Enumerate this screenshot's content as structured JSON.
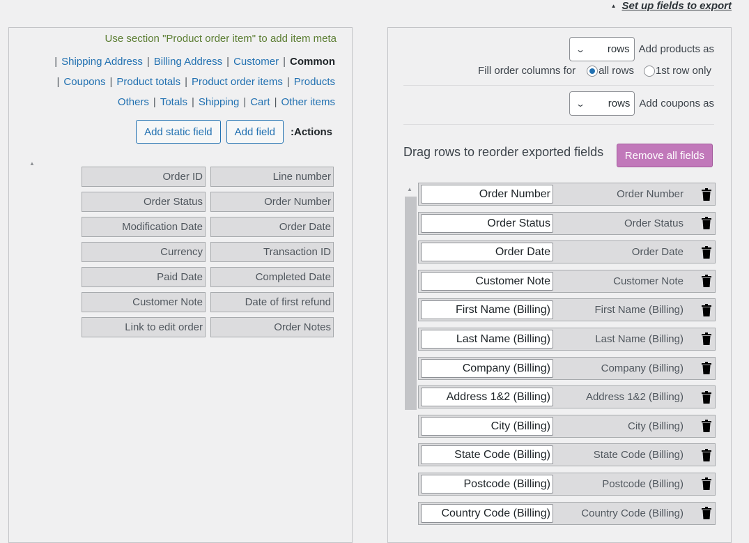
{
  "header": {
    "setup_link": "Set up fields to export"
  },
  "left": {
    "hint": "Use section \"Product order item\" to add item meta",
    "sections_row1": [
      {
        "label": "Shipping Address",
        "current": false
      },
      {
        "label": "Billing Address",
        "current": false
      },
      {
        "label": "Customer",
        "current": false
      },
      {
        "label": "Common",
        "current": true
      }
    ],
    "sections_row2": [
      {
        "label": "Coupons",
        "current": false
      },
      {
        "label": "Product totals",
        "current": false
      },
      {
        "label": "Product order items",
        "current": false
      },
      {
        "label": "Products",
        "current": false
      }
    ],
    "sections_row3": [
      {
        "label": "Others",
        "current": false
      },
      {
        "label": "Totals",
        "current": false
      },
      {
        "label": "Shipping",
        "current": false
      },
      {
        "label": "Cart",
        "current": false
      },
      {
        "label": "Other items",
        "current": false
      }
    ],
    "add_static_field": "Add static field",
    "add_field": "Add field",
    "actions_label": ":Actions",
    "available_fields": [
      "Order ID",
      "Line number",
      "Order Status",
      "Order Number",
      "Modification Date",
      "Order Date",
      "Currency",
      "Transaction ID",
      "Paid Date",
      "Completed Date",
      "Customer Note",
      "Date of first refund",
      "Link to edit order",
      "Order Notes"
    ]
  },
  "right": {
    "products_select": "rows",
    "products_label": "Add products as",
    "fill_label": "Fill order columns for",
    "radio_all": "all rows",
    "radio_first": "1st row only",
    "radio_selected": "all",
    "coupons_select": "rows",
    "coupons_label": "Add coupons as",
    "drag_title": "Drag rows to reorder exported fields",
    "remove_all": "Remove all fields",
    "export_fields": [
      {
        "value": "Order Number",
        "label": "Order Number"
      },
      {
        "value": "Order Status",
        "label": "Order Status"
      },
      {
        "value": "Order Date",
        "label": "Order Date"
      },
      {
        "value": "Customer Note",
        "label": "Customer Note"
      },
      {
        "value": "First Name (Billing)",
        "label": "First Name (Billing)"
      },
      {
        "value": "Last Name (Billing)",
        "label": "Last Name (Billing)"
      },
      {
        "value": "Company (Billing)",
        "label": "Company (Billing)"
      },
      {
        "value": "Address 1&2 (Billing)",
        "label": "Address 1&2 (Billing)"
      },
      {
        "value": "City (Billing)",
        "label": "City (Billing)"
      },
      {
        "value": "State Code (Billing)",
        "label": "State Code (Billing)"
      },
      {
        "value": "Postcode (Billing)",
        "label": "Postcode (Billing)"
      },
      {
        "value": "Country Code (Billing)",
        "label": "Country Code (Billing)"
      }
    ]
  },
  "icons": {
    "trash": "trash-icon",
    "chevron": "chevron-down-icon",
    "collapse": "triangle-up-icon"
  },
  "colors": {
    "link": "#2271b1",
    "hint": "#5b7d32",
    "remove_button": "#c178ba"
  }
}
